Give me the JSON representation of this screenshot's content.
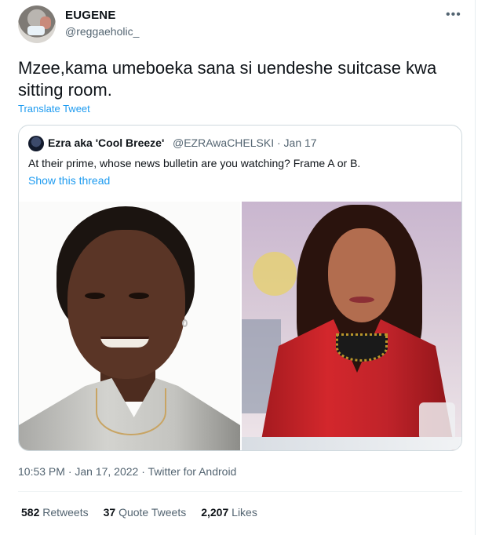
{
  "author": {
    "name": "EUGENE",
    "handle": "@reggaeholic_",
    "more_icon": "more-horizontal-icon"
  },
  "tweet": {
    "text": "Mzee,kama umeboeka sana si uendeshe suitcase kwa sitting room.",
    "translate_label": "Translate Tweet"
  },
  "quoted": {
    "name": "Ezra aka 'Cool Breeze'",
    "handle_date": "@EZRAwaCHELSKI · Jan 17",
    "text": "At their prime, whose news bulletin are you watching? Frame A or B.",
    "thread_link": "Show this thread"
  },
  "meta": {
    "timestamp": "10:53 PM · Jan 17, 2022 · Twitter for Android"
  },
  "stats": {
    "retweets_count": "582",
    "retweets_label": "Retweets",
    "quotes_count": "37",
    "quotes_label": "Quote Tweets",
    "likes_count": "2,207",
    "likes_label": "Likes"
  },
  "colors": {
    "link": "#1d9bf0",
    "secondary_text": "#536471",
    "primary_text": "#0f1419",
    "border": "#cfd9de"
  }
}
